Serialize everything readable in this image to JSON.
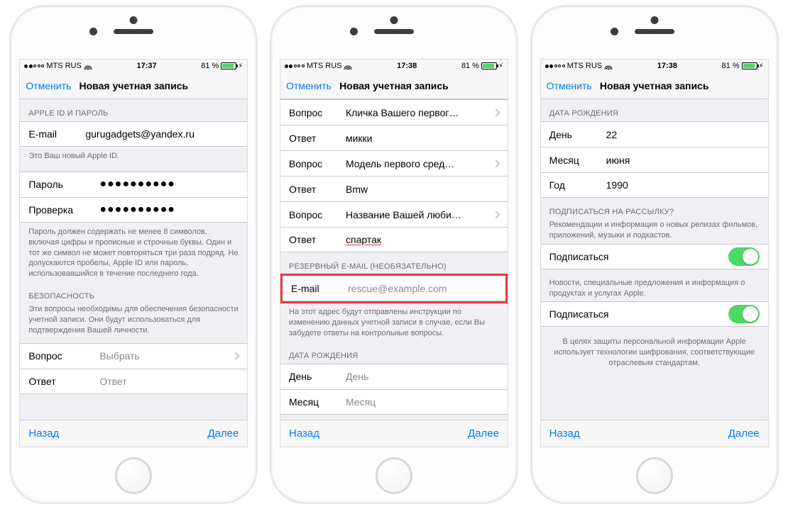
{
  "status": {
    "carrier": "MTS RUS",
    "battery_pct": "81 %"
  },
  "nav": {
    "cancel": "Отменить",
    "title": "Новая учетная запись"
  },
  "toolbar": {
    "back": "Назад",
    "next": "Далее"
  },
  "screen1": {
    "time": "17:37",
    "section_id": "APPLE ID И ПАРОЛЬ",
    "email_label": "E-mail",
    "email_value": "gurugadgets@yandex.ru",
    "id_footer": "Это Ваш новый Apple ID.",
    "password_label": "Пароль",
    "password_value": "●●●●●●●●●●",
    "verify_label": "Проверка",
    "verify_value": "●●●●●●●●●●",
    "pwd_footer": "Пароль должен содержать не менее 8 символов, включая цифры и прописные и строчные буквы. Один и тот же символ не может повторяться три раза подряд. Не допускаются пробелы, Apple ID или пароль, использовавшийся в течение последнего года.",
    "security_header": "БЕЗОПАСНОСТЬ",
    "security_footer": "Эти вопросы необходимы для обеспечения безопасности учетной записи. Они будут использоваться для подтверждения Вашей личности.",
    "question_label": "Вопрос",
    "question_placeholder": "Выбрать",
    "answer_label": "Ответ",
    "answer_placeholder": "Ответ"
  },
  "screen2": {
    "time": "17:38",
    "q_label": "Вопрос",
    "a_label": "Ответ",
    "q1": "Кличка Вашего первог…",
    "a1": "микки",
    "q2": "Модель первого сред…",
    "a2": "Bmw",
    "q3": "Название Вашей люби…",
    "a3": "спартак",
    "rescue_header": "РЕЗЕРВНЫЙ E-MAIL (НЕОБЯЗАТЕЛЬНО)",
    "rescue_label": "E-mail",
    "rescue_placeholder": "rescue@example.com",
    "rescue_footer": "На этот адрес будут отправлены инструкции по изменению данных учетной записи в случае, если Вы забудете ответы на контрольные вопросы.",
    "dob_header": "ДАТА РОЖДЕНИЯ",
    "day_label": "День",
    "day_placeholder": "День",
    "month_label": "Месяц",
    "month_placeholder": "Месяц"
  },
  "screen3": {
    "time": "17:38",
    "dob_header": "ДАТА РОЖДЕНИЯ",
    "day_label": "День",
    "day_value": "22",
    "month_label": "Месяц",
    "month_value": "июня",
    "year_label": "Год",
    "year_value": "1990",
    "sub_header": "ПОДПИСАТЬСЯ НА РАССЫЛКУ?",
    "sub1_desc": "Рекомендации и информация о новых релизах фильмов, приложений, музыки и подкастов.",
    "sub_label": "Подписаться",
    "sub2_desc": "Новости, специальные предложения и информация о продуктах и услугах Apple.",
    "privacy": "В целях защиты персональной информации Apple использует технологии шифрования, соответствующие отраслевым стандартам."
  }
}
